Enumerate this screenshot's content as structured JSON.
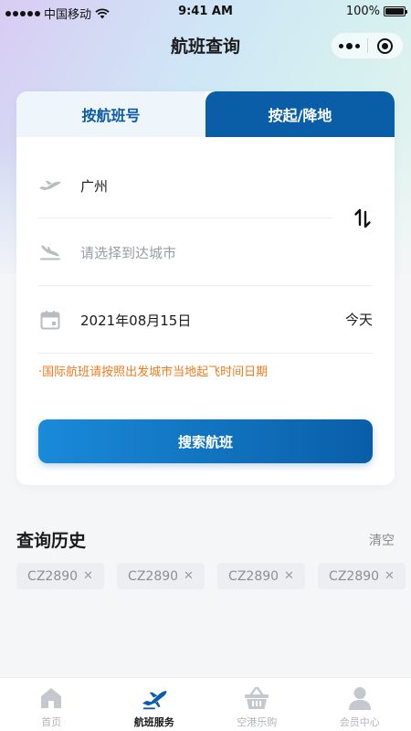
{
  "status_bar": {
    "carrier": "中国移动",
    "time": "9:41 AM",
    "battery": "100%"
  },
  "nav": {
    "title": "航班查询"
  },
  "search": {
    "tabs": [
      {
        "label": "按航班号",
        "active": false
      },
      {
        "label": "按起/降地",
        "active": true
      }
    ],
    "departure_city": "广州",
    "arrival_placeholder": "请选择到达城市",
    "date": "2021年08月15日",
    "date_tag": "今天",
    "notice": "·国际航班请按照出发城市当地起飞时间日期",
    "search_button": "搜索航班"
  },
  "history": {
    "title": "查询历史",
    "clear": "清空",
    "items": [
      "CZ2890",
      "CZ2890",
      "CZ2890",
      "CZ2890"
    ]
  },
  "tabbar": {
    "items": [
      {
        "label": "首页",
        "icon": "home-icon"
      },
      {
        "label": "航班服务",
        "icon": "plane-icon",
        "active": true
      },
      {
        "label": "空港乐购",
        "icon": "basket-icon"
      },
      {
        "label": "会员中心",
        "icon": "user-icon"
      }
    ]
  },
  "colors": {
    "primary": "#0a5ea8",
    "accent_orange": "#f07b1c",
    "tab_inactive_bg": "#eef6fb"
  }
}
